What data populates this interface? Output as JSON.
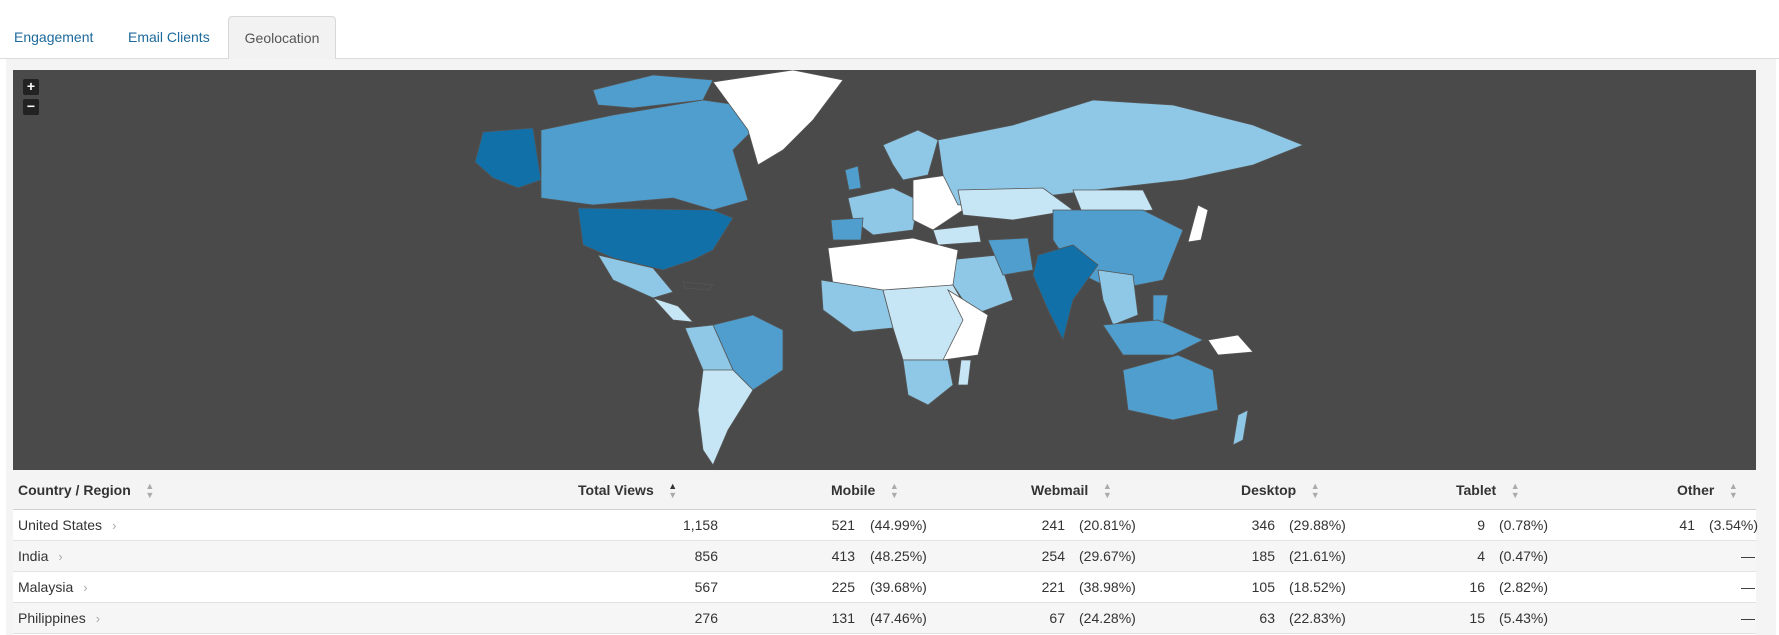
{
  "tabs": [
    {
      "label": "Engagement",
      "active": false
    },
    {
      "label": "Email Clients",
      "active": false
    },
    {
      "label": "Geolocation",
      "active": true
    }
  ],
  "map": {
    "zoom_in": "+",
    "zoom_out": "−",
    "ocean_color": "#4a4a4a",
    "scale_colors": [
      "#ffffff",
      "#c6e6f6",
      "#8ec8e6",
      "#4f9ecd",
      "#1270a8"
    ]
  },
  "table": {
    "columns": [
      {
        "label": "Country / Region"
      },
      {
        "label": "Total Views"
      },
      {
        "label": "Mobile"
      },
      {
        "label": "Webmail"
      },
      {
        "label": "Desktop"
      },
      {
        "label": "Tablet"
      },
      {
        "label": "Other"
      }
    ],
    "rows": [
      {
        "country": "United States",
        "total": "1,158",
        "mobile": "521",
        "mobile_pct": "(44.99%)",
        "webmail": "241",
        "webmail_pct": "(20.81%)",
        "desktop": "346",
        "desktop_pct": "(29.88%)",
        "tablet": "9",
        "tablet_pct": "(0.78%)",
        "other": "41",
        "other_pct": "(3.54%)"
      },
      {
        "country": "India",
        "total": "856",
        "mobile": "413",
        "mobile_pct": "(48.25%)",
        "webmail": "254",
        "webmail_pct": "(29.67%)",
        "desktop": "185",
        "desktop_pct": "(21.61%)",
        "tablet": "4",
        "tablet_pct": "(0.47%)",
        "other": "—",
        "other_pct": ""
      },
      {
        "country": "Malaysia",
        "total": "567",
        "mobile": "225",
        "mobile_pct": "(39.68%)",
        "webmail": "221",
        "webmail_pct": "(38.98%)",
        "desktop": "105",
        "desktop_pct": "(18.52%)",
        "tablet": "16",
        "tablet_pct": "(2.82%)",
        "other": "—",
        "other_pct": ""
      },
      {
        "country": "Philippines",
        "total": "276",
        "mobile": "131",
        "mobile_pct": "(47.46%)",
        "webmail": "67",
        "webmail_pct": "(24.28%)",
        "desktop": "63",
        "desktop_pct": "(22.83%)",
        "tablet": "15",
        "tablet_pct": "(5.43%)",
        "other": "—",
        "other_pct": ""
      }
    ]
  }
}
